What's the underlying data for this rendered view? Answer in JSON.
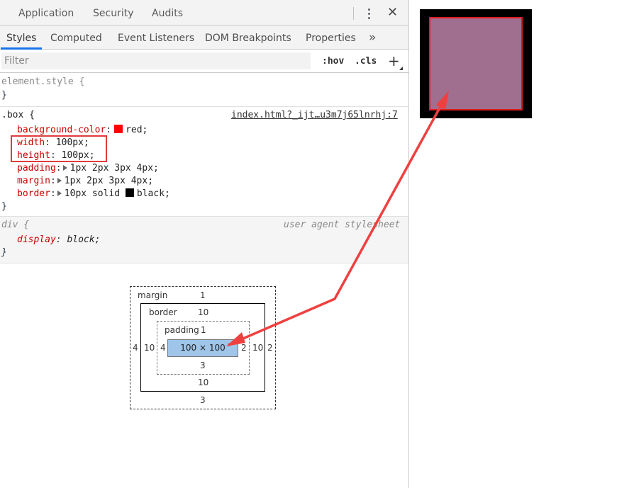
{
  "top_tabs": [
    "Application",
    "Security",
    "Audits"
  ],
  "sub_tabs": [
    "Styles",
    "Computed",
    "Event Listeners",
    "DOM Breakpoints",
    "Properties"
  ],
  "active_sub_tab": "Styles",
  "filter": {
    "placeholder": "Filter",
    "hov_label": ":hov",
    "cls_label": ".cls",
    "add_label": "+"
  },
  "element_style": {
    "selector": "element.style {",
    "close": "}"
  },
  "box_rule": {
    "selector": ".box {",
    "source": "index.html?_ijt…u3m7j65lnrhj:7",
    "decls": [
      {
        "prop": "background-color",
        "value": "red;",
        "swatch": "#ff0000"
      },
      {
        "prop": "width",
        "value": "100px;"
      },
      {
        "prop": "height",
        "value": "100px;"
      },
      {
        "prop": "padding",
        "value": "1px 2px 3px 4px;"
      },
      {
        "prop": "margin",
        "value": "1px 2px 3px 4px;"
      },
      {
        "prop": "border",
        "value": "10px solid ",
        "value2": "black;",
        "swatch": "#000000"
      }
    ],
    "close": "}"
  },
  "div_rule": {
    "selector": "div {",
    "source": "user agent stylesheet",
    "decls": [
      {
        "prop": "display",
        "value": "block;"
      }
    ],
    "close": "}"
  },
  "box_model": {
    "margin": {
      "label": "margin",
      "top": "1",
      "right": "2",
      "bottom": "3",
      "left": "4"
    },
    "border": {
      "label": "border",
      "top": "10",
      "right": "10",
      "bottom": "10",
      "left": "10"
    },
    "padding": {
      "label": "padding",
      "top": "1",
      "right": "2",
      "bottom": "3",
      "left": "4"
    },
    "content": "100 × 100"
  },
  "colors": {
    "accent_blue": "#1a73e8",
    "highlight_red": "#e23b3b",
    "content_blue": "#9fc5e8",
    "preview_fill": "#a06e8f"
  }
}
